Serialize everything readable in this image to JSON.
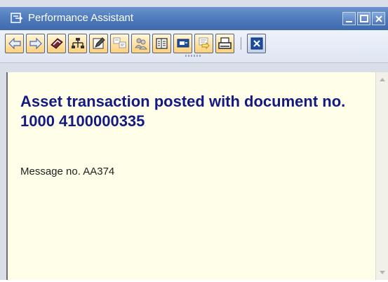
{
  "window": {
    "title": "Performance Assistant",
    "title_icon": "help-window-icon",
    "controls": [
      "minimize-icon",
      "maximize-icon",
      "close-icon"
    ]
  },
  "toolbar": {
    "buttons": [
      {
        "name": "back-button",
        "icon": "arrow-left-icon"
      },
      {
        "name": "forward-button",
        "icon": "arrow-right-icon"
      },
      {
        "name": "glossary-button",
        "icon": "book-icon"
      },
      {
        "name": "technical-info-button",
        "icon": "hierarchy-icon"
      },
      {
        "name": "edit-button",
        "icon": "pencil-icon"
      },
      {
        "name": "translate-button",
        "icon": "translate-icon"
      },
      {
        "name": "users-button",
        "icon": "users-icon"
      },
      {
        "name": "list-button",
        "icon": "list-icon"
      },
      {
        "name": "display-button",
        "icon": "display-icon"
      },
      {
        "name": "settings-button",
        "icon": "settings-icon"
      },
      {
        "name": "print-button",
        "icon": "print-icon"
      },
      {
        "name": "close-help-button",
        "icon": "close-icon"
      }
    ]
  },
  "content": {
    "heading": "Asset transaction posted with document no. 1000 4100000335",
    "message_no": "Message no. AA374"
  },
  "colors": {
    "titlebar": "#4f7bbd",
    "heading": "#141a82",
    "content_bg": "#fefee9"
  }
}
